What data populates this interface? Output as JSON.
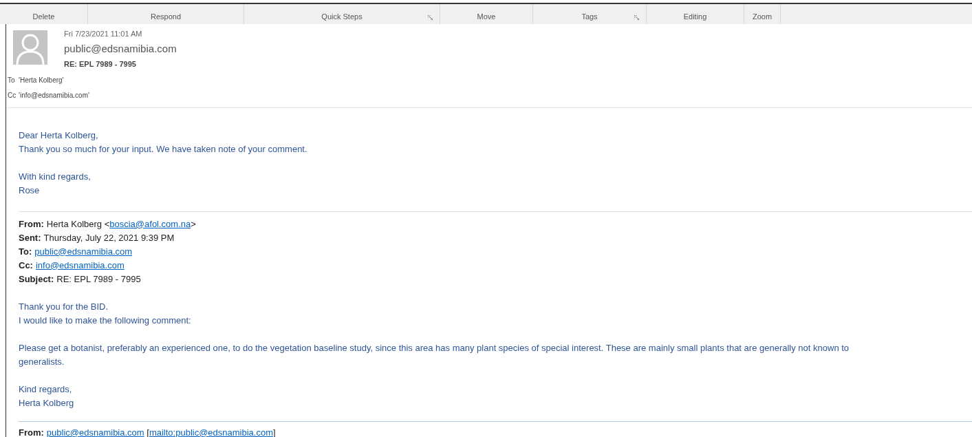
{
  "ribbon": {
    "groups": [
      {
        "label": "Delete",
        "launcher": false
      },
      {
        "label": "Respond",
        "launcher": false
      },
      {
        "label": "Quick Steps",
        "launcher": true
      },
      {
        "label": "Move",
        "launcher": false
      },
      {
        "label": "Tags",
        "launcher": true
      },
      {
        "label": "Editing",
        "launcher": false
      },
      {
        "label": "Zoom",
        "launcher": false
      }
    ]
  },
  "header": {
    "date": "Fri 7/23/2021 11:01 AM",
    "sender": "public@edsnamibia.com",
    "subject": "RE: EPL 7989 - 7995",
    "recipients": [
      {
        "label": "To",
        "value": "'Herta Kolberg'"
      },
      {
        "label": "Cc",
        "value": "'info@edsnamibia.com'"
      }
    ]
  },
  "reply": [
    [
      "Dear Herta Kolberg,",
      "Thank you so much for your input. We have taken note of your comment."
    ],
    [
      "With kind regards,",
      "Rose"
    ]
  ],
  "quoted": {
    "fields": [
      {
        "label": "From:",
        "parts": [
          {
            "text": "Herta Kolberg <",
            "link": false
          },
          {
            "text": "boscia@afol.com.na",
            "link": true
          },
          {
            "text": ">",
            "link": false
          }
        ]
      },
      {
        "label": "Sent:",
        "parts": [
          {
            "text": "Thursday, July 22, 2021 9:39 PM",
            "link": false
          }
        ]
      },
      {
        "label": "To:",
        "parts": [
          {
            "text": "public@edsnamibia.com",
            "link": true
          }
        ]
      },
      {
        "label": "Cc:",
        "parts": [
          {
            "text": "info@edsnamibia.com",
            "link": true
          }
        ]
      },
      {
        "label": "Subject:",
        "parts": [
          {
            "text": "RE: EPL 7989 - 7995",
            "link": false
          }
        ]
      }
    ],
    "body": [
      [
        "Thank you for the BID.",
        "I would like to make the following comment:"
      ],
      [
        "Please get a botanist, preferably an experienced one, to do the vegetation baseline study, since this area has many plant species of special interest. These are mainly small plants that are generally not known to generalists."
      ],
      [
        "Kind regards,",
        "Herta Kolberg"
      ]
    ]
  },
  "earlier": {
    "label": "From:",
    "parts": [
      {
        "text": "public@edsnamibia.com",
        "link": true
      },
      {
        "text": " [",
        "link": false
      },
      {
        "text": "mailto:public@edsnamibia.com",
        "link": true
      },
      {
        "text": "]",
        "link": false
      }
    ]
  }
}
